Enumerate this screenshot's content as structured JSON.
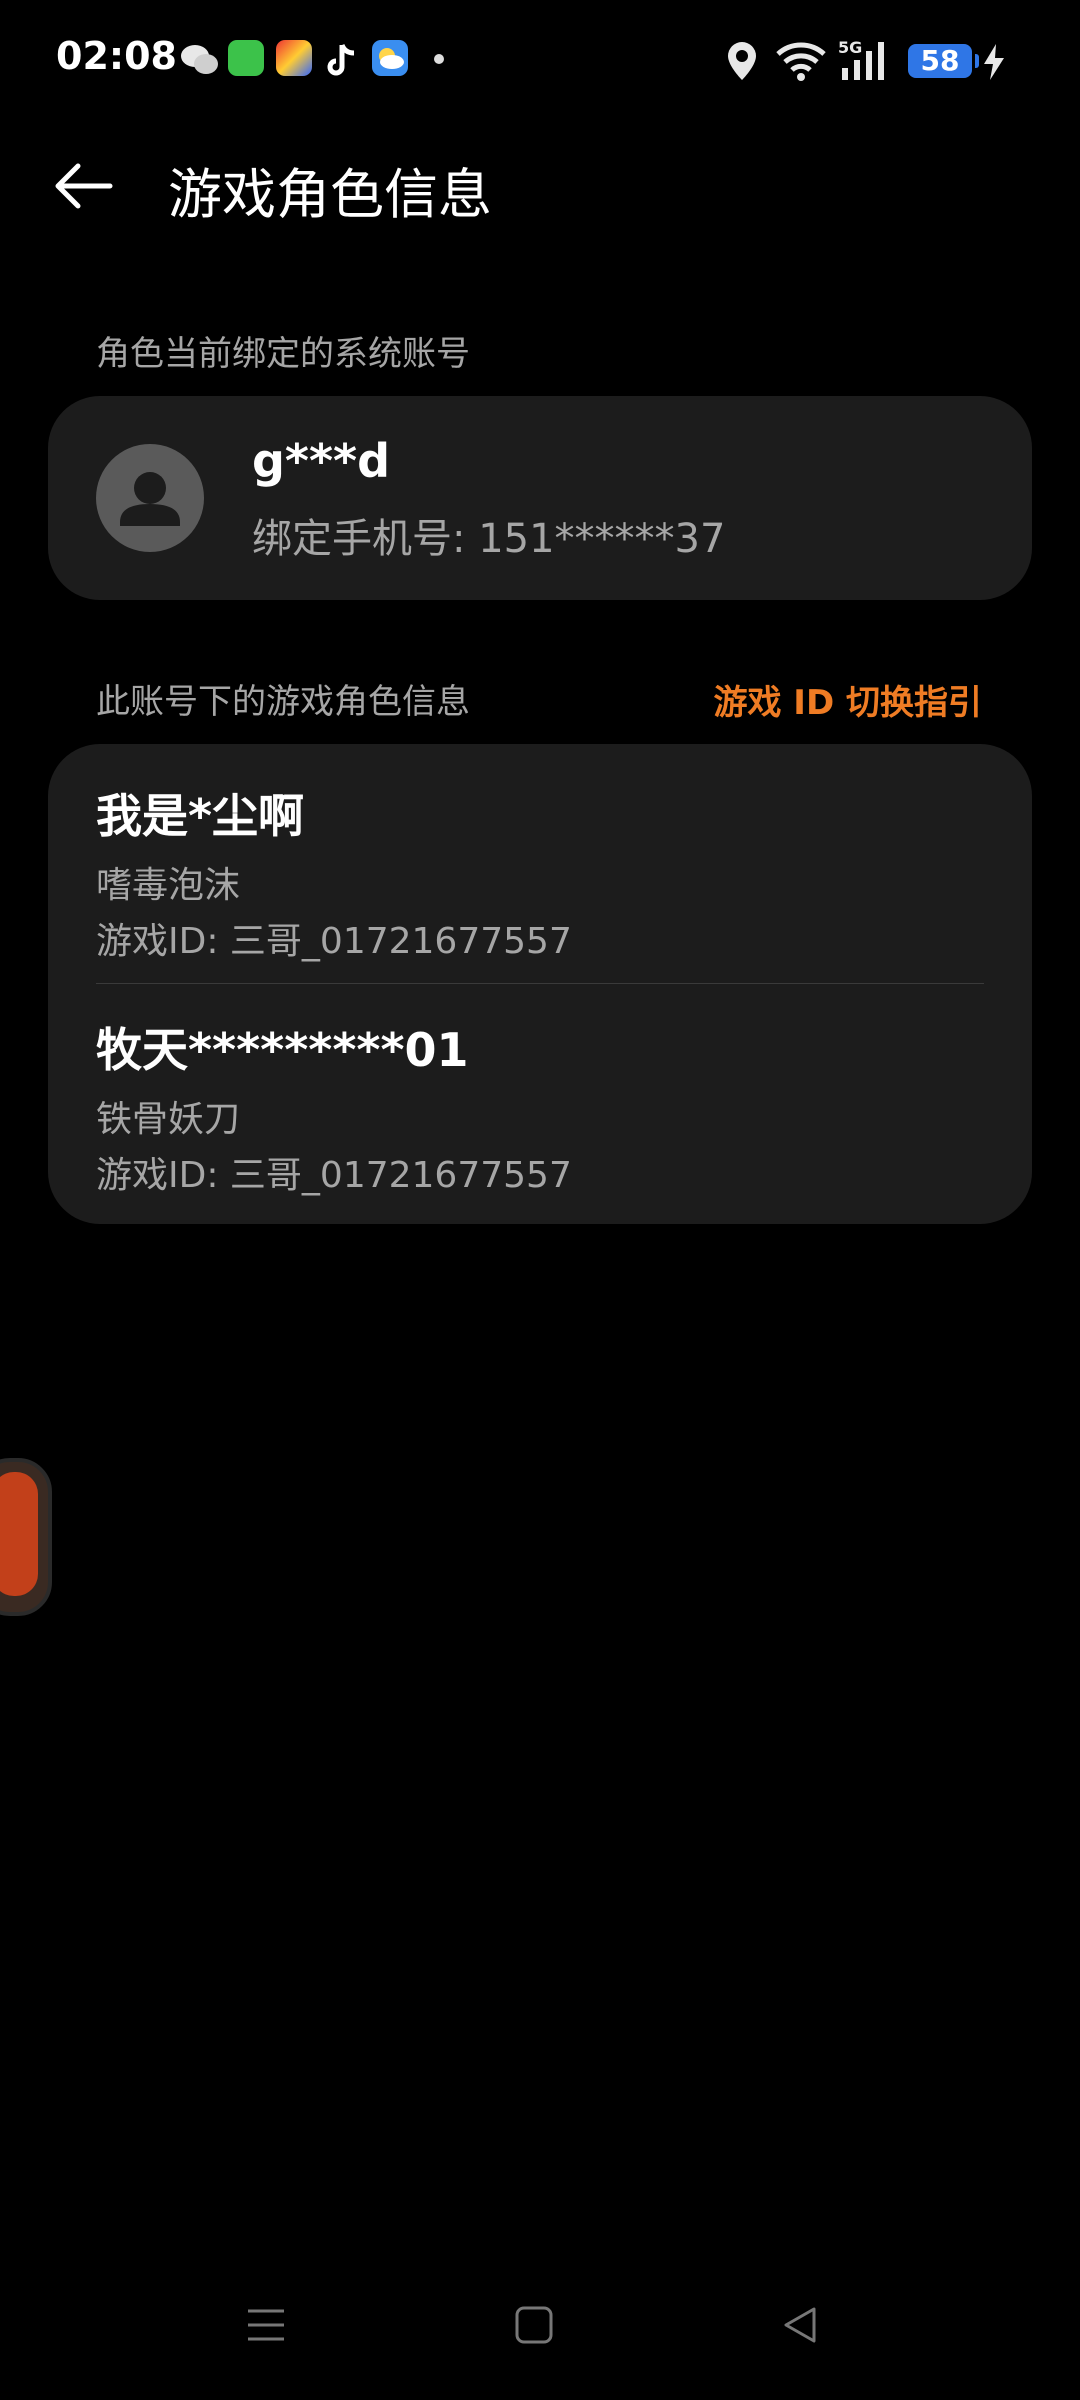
{
  "status_bar": {
    "time": "02:08",
    "notification_icons": [
      "wechat-icon",
      "messages-icon",
      "game-icon",
      "tiktok-icon",
      "weather-icon",
      "dot-icon"
    ],
    "right_icons": [
      "location-icon",
      "wifi-icon",
      "signal-5g-icon"
    ],
    "network_label": "5G",
    "battery": "58"
  },
  "header": {
    "title": "游戏角色信息"
  },
  "account_section": {
    "label": "角色当前绑定的系统账号",
    "account_name": "g***d",
    "phone": "绑定手机号: 151******37"
  },
  "roles_section": {
    "label": "此账号下的游戏角色信息",
    "guide_link": "游戏 ID 切换指引",
    "roles": [
      {
        "name": "我是*尘啊",
        "subtitle": "嗜毒泡沫",
        "game_id": "游戏ID: 三哥_01721677557"
      },
      {
        "name": "牧天*********01",
        "subtitle": "铁骨妖刀",
        "game_id": "游戏ID: 三哥_01721677557"
      }
    ]
  },
  "colors": {
    "accent": "#ef7c24",
    "card": "#1c1c1c",
    "secondary_text": "#a6a6a6"
  }
}
